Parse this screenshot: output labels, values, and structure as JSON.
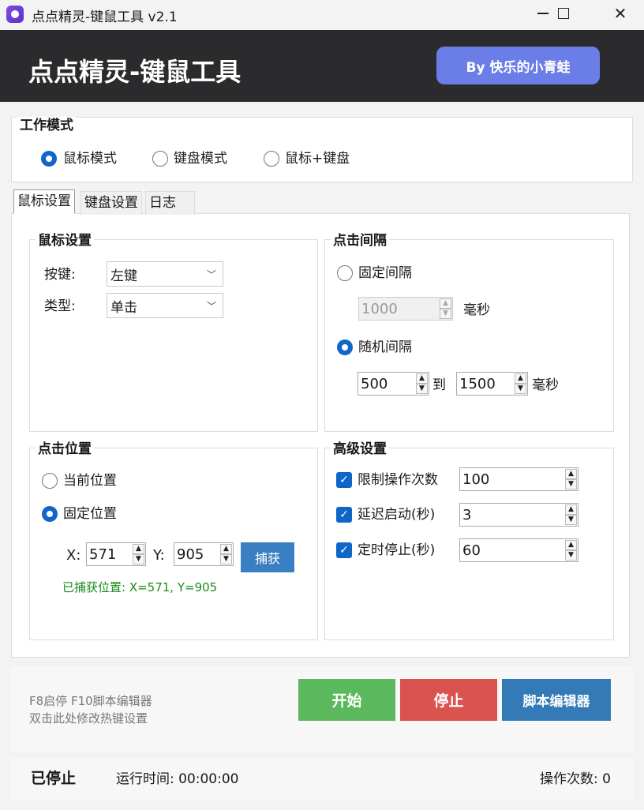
{
  "window": {
    "title": "点点精灵-键鼠工具 v2.1",
    "minimize": "—",
    "maximize": "☐",
    "close": "✕"
  },
  "header": {
    "title": "点点精灵-键鼠工具",
    "author_button": "By 快乐的小青蛙",
    "accent_color": "#6b7de6"
  },
  "work_mode": {
    "title": "工作模式",
    "options": [
      {
        "label": "鼠标模式",
        "selected": true
      },
      {
        "label": "键盘模式",
        "selected": false
      },
      {
        "label": "鼠标+键盘",
        "selected": false
      }
    ]
  },
  "tabs": [
    {
      "label": "鼠标设置",
      "active": true
    },
    {
      "label": "键盘设置",
      "active": false
    },
    {
      "label": "日志",
      "active": false
    }
  ],
  "mouse_settings": {
    "title": "鼠标设置",
    "button_label": "按键:",
    "button_value": "左键",
    "type_label": "类型:",
    "type_value": "单击"
  },
  "click_interval": {
    "title": "点击间隔",
    "fixed_label": "固定间隔",
    "fixed_selected": false,
    "fixed_value": "1000",
    "fixed_unit": "毫秒",
    "random_label": "随机间隔",
    "random_selected": true,
    "random_min": "500",
    "random_to": "到",
    "random_max": "1500",
    "random_unit": "毫秒"
  },
  "click_position": {
    "title": "点击位置",
    "current_label": "当前位置",
    "current_selected": false,
    "fixed_label": "固定位置",
    "fixed_selected": true,
    "x_label": "X:",
    "x_value": "571",
    "y_label": "Y:",
    "y_value": "905",
    "capture_button": "捕获",
    "captured_text": "已捕获位置: X=571, Y=905"
  },
  "advanced": {
    "title": "高级设置",
    "items": [
      {
        "label": "限制操作次数",
        "checked": true,
        "value": "100"
      },
      {
        "label": "延迟启动(秒)",
        "checked": true,
        "value": "3"
      },
      {
        "label": "定时停止(秒)",
        "checked": true,
        "value": "60"
      }
    ]
  },
  "controls": {
    "hint_line1": "F8启停 F10脚本编辑器",
    "hint_line2": "双击此处修改热键设置",
    "start": "开始",
    "stop": "停止",
    "script_editor": "脚本编辑器",
    "start_color": "#5cb85c",
    "stop_color": "#d9534f",
    "editor_color": "#337ab7"
  },
  "status": {
    "state": "已停止",
    "runtime": "运行时间: 00:00:00",
    "op_count": "操作次数: 0"
  }
}
